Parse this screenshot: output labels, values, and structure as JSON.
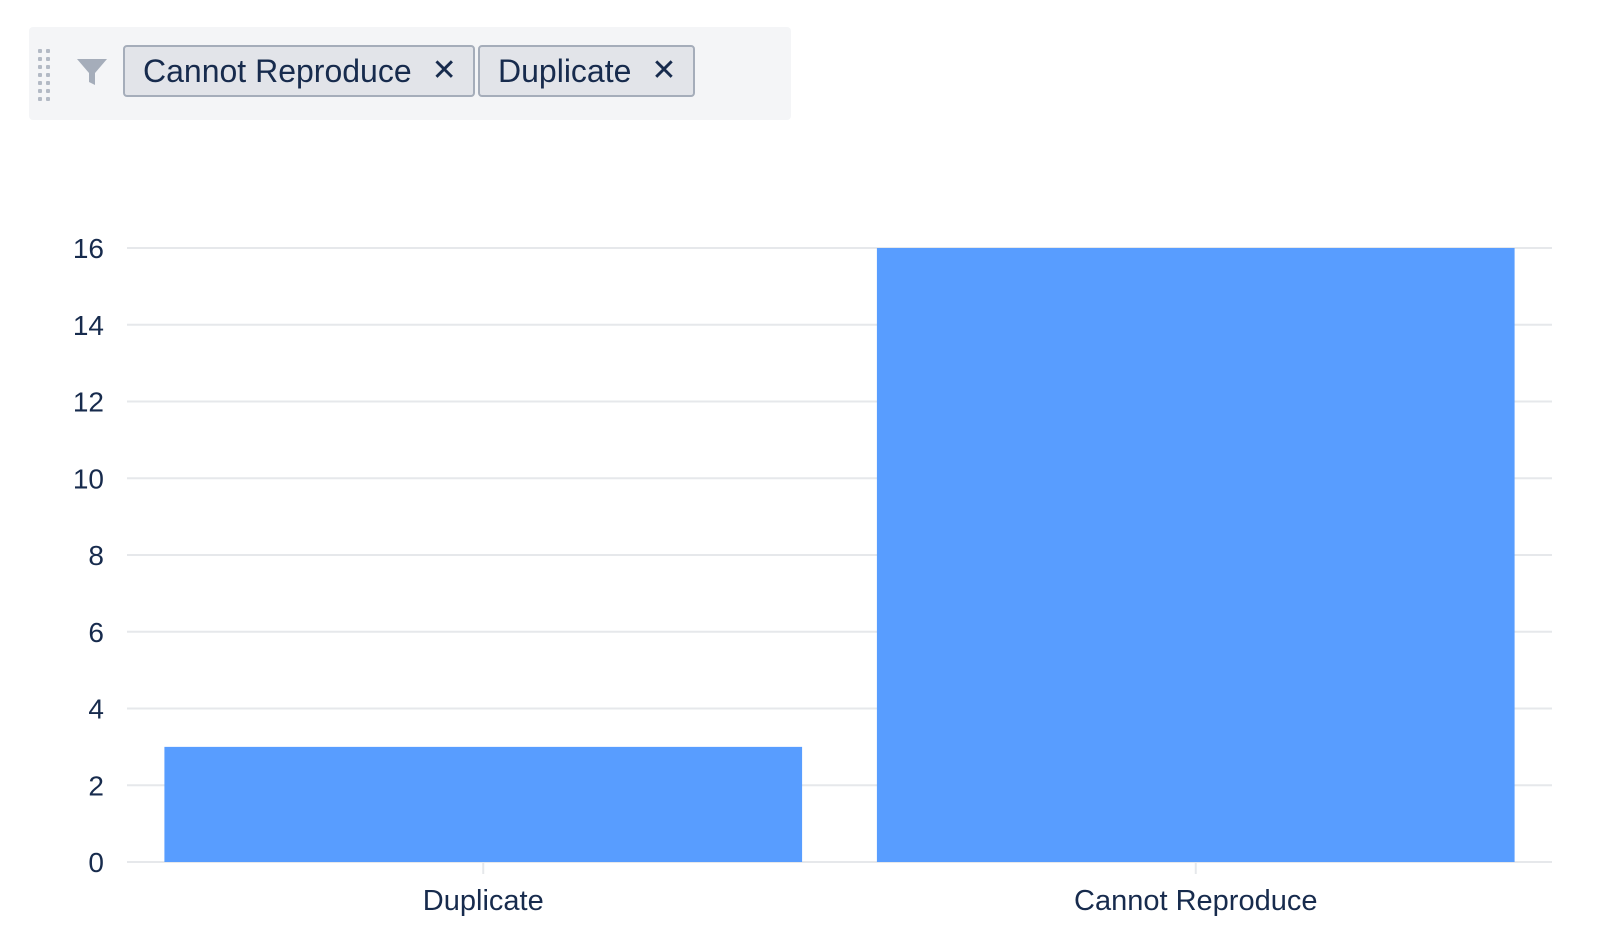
{
  "filter_bar": {
    "drag_handle_icon": "grip-vertical-icon",
    "filter_icon": "funnel-icon",
    "chips": [
      {
        "label": "Cannot Reproduce",
        "remove_icon": "close-icon"
      },
      {
        "label": "Duplicate",
        "remove_icon": "close-icon"
      }
    ]
  },
  "colors": {
    "bar": "#589dff",
    "grid": "#e6e8eb",
    "text": "#172b4d",
    "filter_bar_bg": "#f4f5f7"
  },
  "chart_data": {
    "type": "bar",
    "categories": [
      "Duplicate",
      "Cannot Reproduce"
    ],
    "values": [
      3,
      16
    ],
    "ylim": [
      0,
      16
    ],
    "yticks": [
      "0",
      "2",
      "4",
      "6",
      "8",
      "10",
      "12",
      "14",
      "16"
    ],
    "grid": true,
    "title": "",
    "xlabel": "",
    "ylabel": ""
  }
}
